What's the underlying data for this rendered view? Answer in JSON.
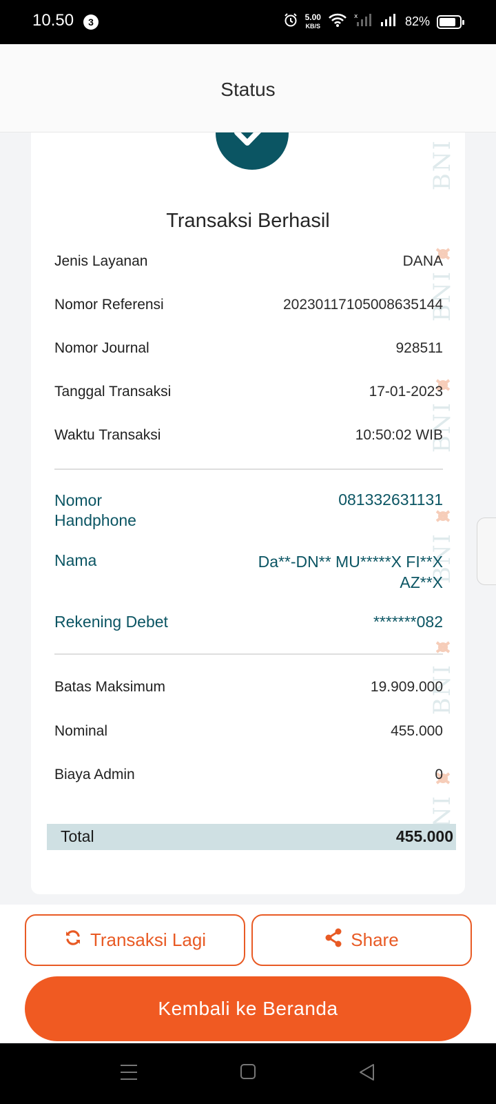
{
  "status_bar": {
    "time": "10.50",
    "notification_count": "3",
    "net_speed_value": "5.00",
    "net_speed_unit": "KB/S",
    "battery_percent": "82%",
    "battery_level": 0.82
  },
  "header": {
    "title": "Status"
  },
  "receipt": {
    "heading": "Transaksi Berhasil",
    "watermark_text": "BNI",
    "details": [
      {
        "label": "Jenis Layanan",
        "value": "DANA"
      },
      {
        "label": "Nomor Referensi",
        "value": "20230117105008635144"
      },
      {
        "label": "Nomor Journal",
        "value": "928511"
      },
      {
        "label": "Tanggal Transaksi",
        "value": "17-01-2023"
      },
      {
        "label": "Waktu Transaksi",
        "value": "10:50:02 WIB"
      }
    ],
    "customer": [
      {
        "label_line1": "Nomor",
        "label_line2": "Handphone",
        "value": "081332631131"
      },
      {
        "label": "Nama",
        "value_line1": "Da**-DN** MU*****X FI**X",
        "value_line2": "AZ**X"
      },
      {
        "label": "Rekening Debet",
        "value": "*******082"
      }
    ],
    "amounts": [
      {
        "label": "Batas Maksimum",
        "value": "19.909.000"
      },
      {
        "label": "Nominal",
        "value": "455.000"
      },
      {
        "label": "Biaya Admin",
        "value": "0"
      }
    ],
    "total": {
      "label": "Total",
      "value": "455.000"
    }
  },
  "actions": {
    "again_label": "Transaksi Lagi",
    "share_label": "Share",
    "home_label": "Kembali ke Beranda"
  },
  "icons": {
    "success": "check-icon",
    "again": "refresh-icon",
    "share": "share-icon",
    "nav_menu": "menu-icon",
    "nav_home": "home-icon",
    "nav_back": "back-icon"
  },
  "colors": {
    "accent": "#f05a22",
    "primary_teal": "#0b5563",
    "total_highlight": "#cfe0e3"
  }
}
